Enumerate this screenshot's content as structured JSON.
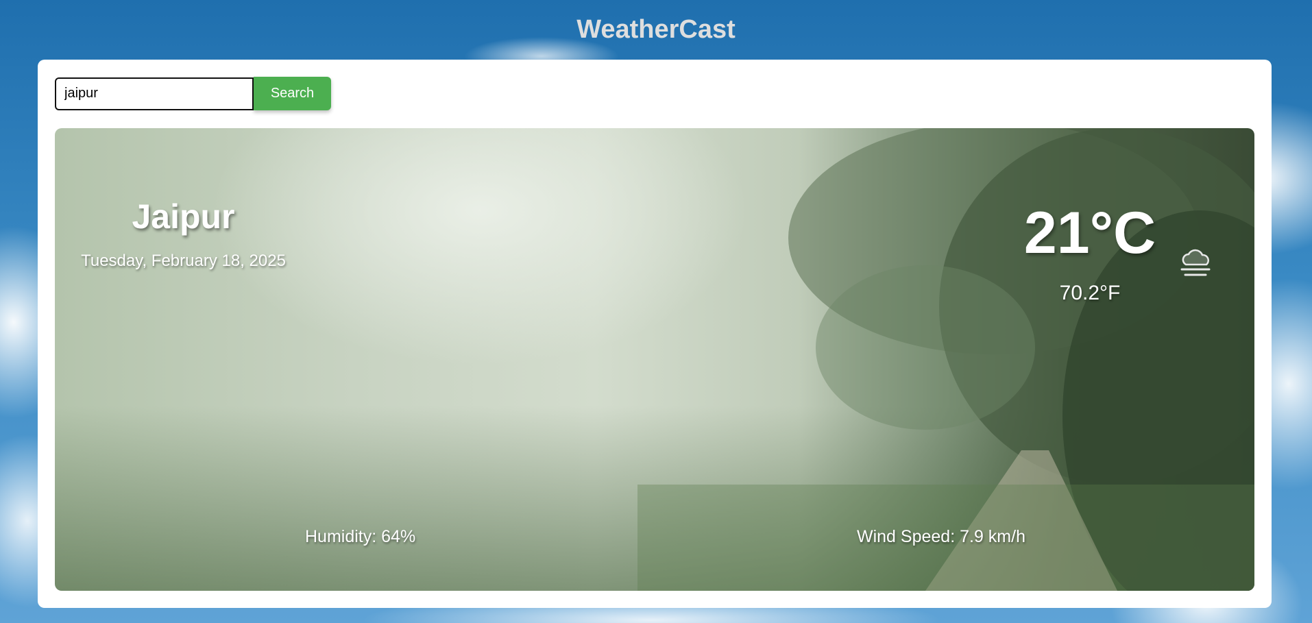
{
  "app": {
    "title": "WeatherCast"
  },
  "search": {
    "value": "jaipur",
    "button_label": "Search"
  },
  "weather": {
    "city": "Jaipur",
    "date": "Tuesday, February 18, 2025",
    "temp_c": "21°C",
    "temp_f": "70.2°F",
    "condition_icon": "fog-icon",
    "humidity_label": "Humidity:",
    "humidity_value": "64%",
    "wind_label": "Wind Speed:",
    "wind_value": "7.9 km/h"
  },
  "colors": {
    "accent": "#4caf50",
    "title": "#dedede",
    "background": "#2b7bbb"
  }
}
